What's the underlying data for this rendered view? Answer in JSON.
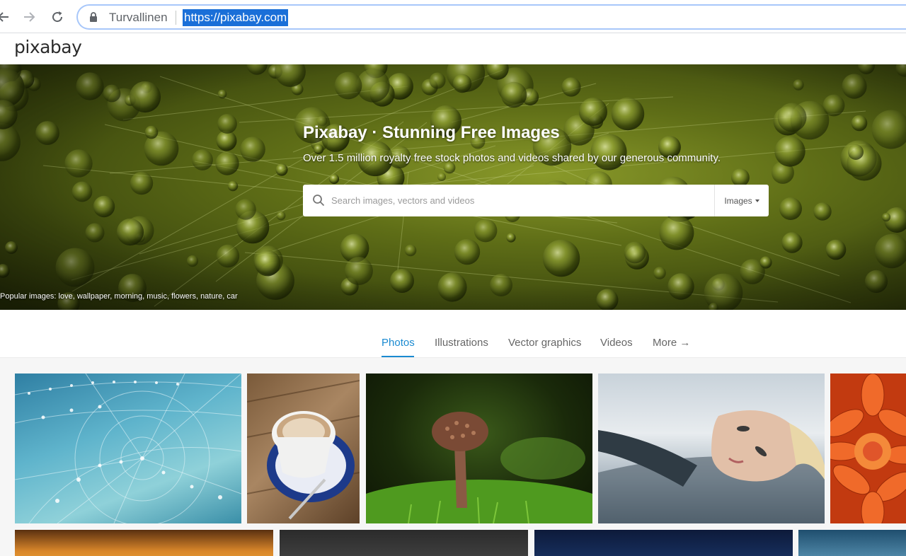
{
  "browser": {
    "security_label": "Turvallinen",
    "url": "https://pixabay.com"
  },
  "site": {
    "logo": "pixabay"
  },
  "hero": {
    "title": "Pixabay · Stunning Free Images",
    "subtitle": "Over 1.5 million royalty free stock photos and videos shared by our generous community.",
    "search_placeholder": "Search images, vectors and videos",
    "search_type": "Images",
    "popular": "Popular images: love, wallpaper, morning, music, flowers, nature, car"
  },
  "tabs": [
    {
      "label": "Photos",
      "active": true
    },
    {
      "label": "Illustrations",
      "active": false
    },
    {
      "label": "Vector graphics",
      "active": false
    },
    {
      "label": "Videos",
      "active": false
    },
    {
      "label": "More →",
      "active": false
    }
  ],
  "colors": {
    "accent": "#1a8ad1",
    "url_highlight": "#1a6fd8"
  }
}
